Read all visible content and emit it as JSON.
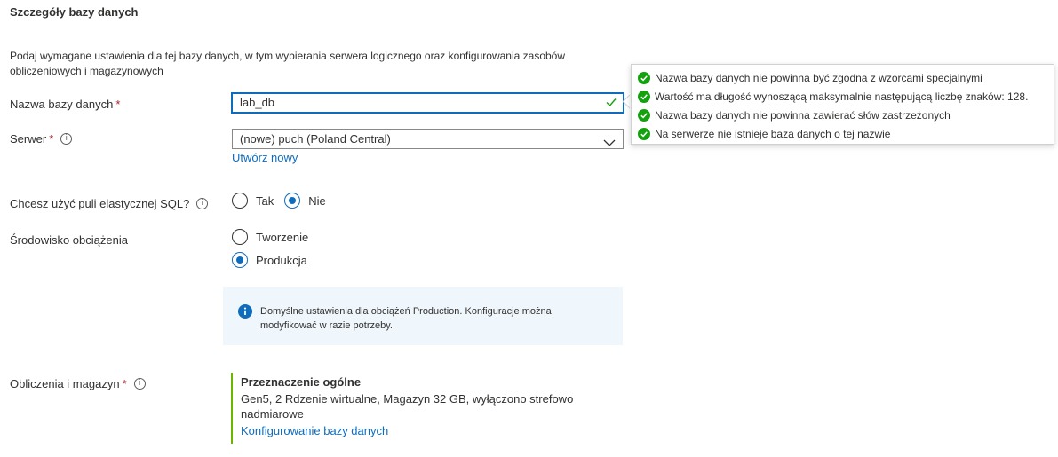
{
  "section": {
    "title": "Szczegóły bazy danych",
    "description": "Podaj wymagane ustawienia dla tej bazy danych, w tym wybierania serwera logicznego oraz konfigurowania zasobów obliczeniowych i magazynowych"
  },
  "db_name": {
    "label": "Nazwa bazy danych",
    "required_mark": "*",
    "value": "lab_db"
  },
  "server": {
    "label": "Serwer",
    "required_mark": "*",
    "info_glyph": "i",
    "selected": "(nowe) puch (Poland Central)",
    "create_link": "Utwórz nowy"
  },
  "elastic_pool": {
    "label": "Chcesz użyć puli elastycznej SQL?",
    "info_glyph": "i",
    "options": [
      "Tak",
      "Nie"
    ],
    "selected": "Nie"
  },
  "workload": {
    "label": "Środowisko obciążenia",
    "options": [
      "Tworzenie",
      "Produkcja"
    ],
    "selected": "Produkcja",
    "info_message": "Domyślne ustawienia dla obciążeń Production. Konfiguracje można modyfikować w razie potrzeby."
  },
  "compute": {
    "label": "Obliczenia i magazyn",
    "required_mark": "*",
    "info_glyph": "i",
    "tier_title": "Przeznaczenie ogólne",
    "tier_details": "Gen5, 2 Rdzenie wirtualne, Magazyn 32 GB, wyłączono strefowo nadmiarowe",
    "configure_link": "Konfigurowanie bazy danych"
  },
  "validation": {
    "status_color": "#13a10e",
    "messages": [
      "Nazwa bazy danych nie powinna być zgodna z wzorcami specjalnymi",
      "Wartość ma długość wynoszącą maksymalnie następującą liczbę znaków: 128.",
      "Nazwa bazy danych nie powinna zawierać słów zastrzeżonych",
      "Na serwerze nie istnieje baza danych o tej nazwie"
    ]
  },
  "colors": {
    "accent": "#0f6cbd",
    "required": "#a4262c",
    "success": "#13a10e",
    "tier_bar": "#6bb700",
    "info_bg": "#eff6fc"
  },
  "icons": [
    "check-icon",
    "info-icon",
    "chevron-down-icon",
    "success-circle-icon"
  ]
}
